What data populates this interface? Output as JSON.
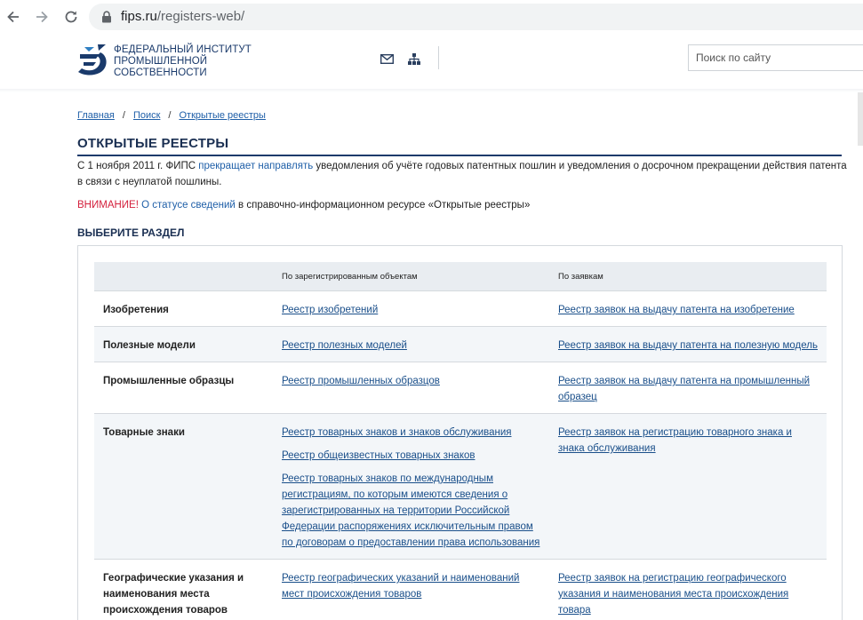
{
  "browser": {
    "url_host": "fips.ru",
    "url_path": "/registers-web/"
  },
  "header": {
    "logo_lines": [
      "ФЕДЕРАЛЬНЫЙ ИНСТИТУТ",
      "ПРОМЫШЛЕННОЙ",
      "СОБСТВЕННОСТИ"
    ],
    "search_placeholder": "Поиск по сайту",
    "icons": [
      "mail-icon",
      "sitemap-icon"
    ]
  },
  "breadcrumb": [
    "Главная",
    "Поиск",
    "Открытые реестры"
  ],
  "breadcrumb_separator": "/",
  "page_title": "ОТКРЫТЫЕ РЕЕСТРЫ",
  "intro": {
    "part1": "С 1 ноября 2011 г. ФИПС ",
    "link1": "прекращает",
    "space": " ",
    "link2": "направлять",
    "part2": " уведомления об учёте годовых патентных пошлин и уведомления о досрочном прекращении действия патента в связи с неуплатой пошлины."
  },
  "warning": {
    "label": "ВНИМАНИЕ!",
    "link": "О статусе сведений",
    "text": " в справочно-информационном ресурсе «Открытые реестры»"
  },
  "section_title": "ВЫБЕРИТЕ РАЗДЕЛ",
  "table": {
    "headers": [
      "",
      "По зарегистрированным объектам",
      "По заявкам"
    ],
    "rows": [
      {
        "name": "Изобретения",
        "registered": [
          "Реестр изобретений"
        ],
        "applications": [
          "Реестр заявок на выдачу патента на изобретение"
        ]
      },
      {
        "name": "Полезные модели",
        "registered": [
          "Реестр полезных моделей"
        ],
        "applications": [
          "Реестр заявок на выдачу патента на полезную модель"
        ]
      },
      {
        "name": "Промышленные образцы",
        "registered": [
          "Реестр промышленных образцов"
        ],
        "applications": [
          "Реестр заявок на выдачу патента на промышленный образец"
        ]
      },
      {
        "name": "Товарные знаки",
        "registered": [
          "Реестр товарных знаков и знаков обслуживания",
          "Реестр общеизвестных товарных знаков",
          "Реестр товарных знаков по международным регистрациям, по которым имеются сведения о зарегистрированных на территории Российской Федерации распоряжениях исключительным правом по договорам о предоставлении права использования"
        ],
        "applications": [
          "Реестр заявок на регистрацию товарного знака и знака обслуживания"
        ]
      },
      {
        "name": "Географические указания и наименования места происхождения товаров",
        "registered": [
          "Реестр географических указаний и наименований мест происхождения товаров"
        ],
        "applications": [
          "Реестр заявок на регистрацию географического указания и наименования места происхождения товара"
        ]
      }
    ]
  },
  "colors": {
    "accent": "#1a3a6b",
    "link": "#1f5fa8",
    "warning": "#d4213d",
    "header_row": "#e9edf1",
    "alt_row": "#f3f6f9"
  }
}
